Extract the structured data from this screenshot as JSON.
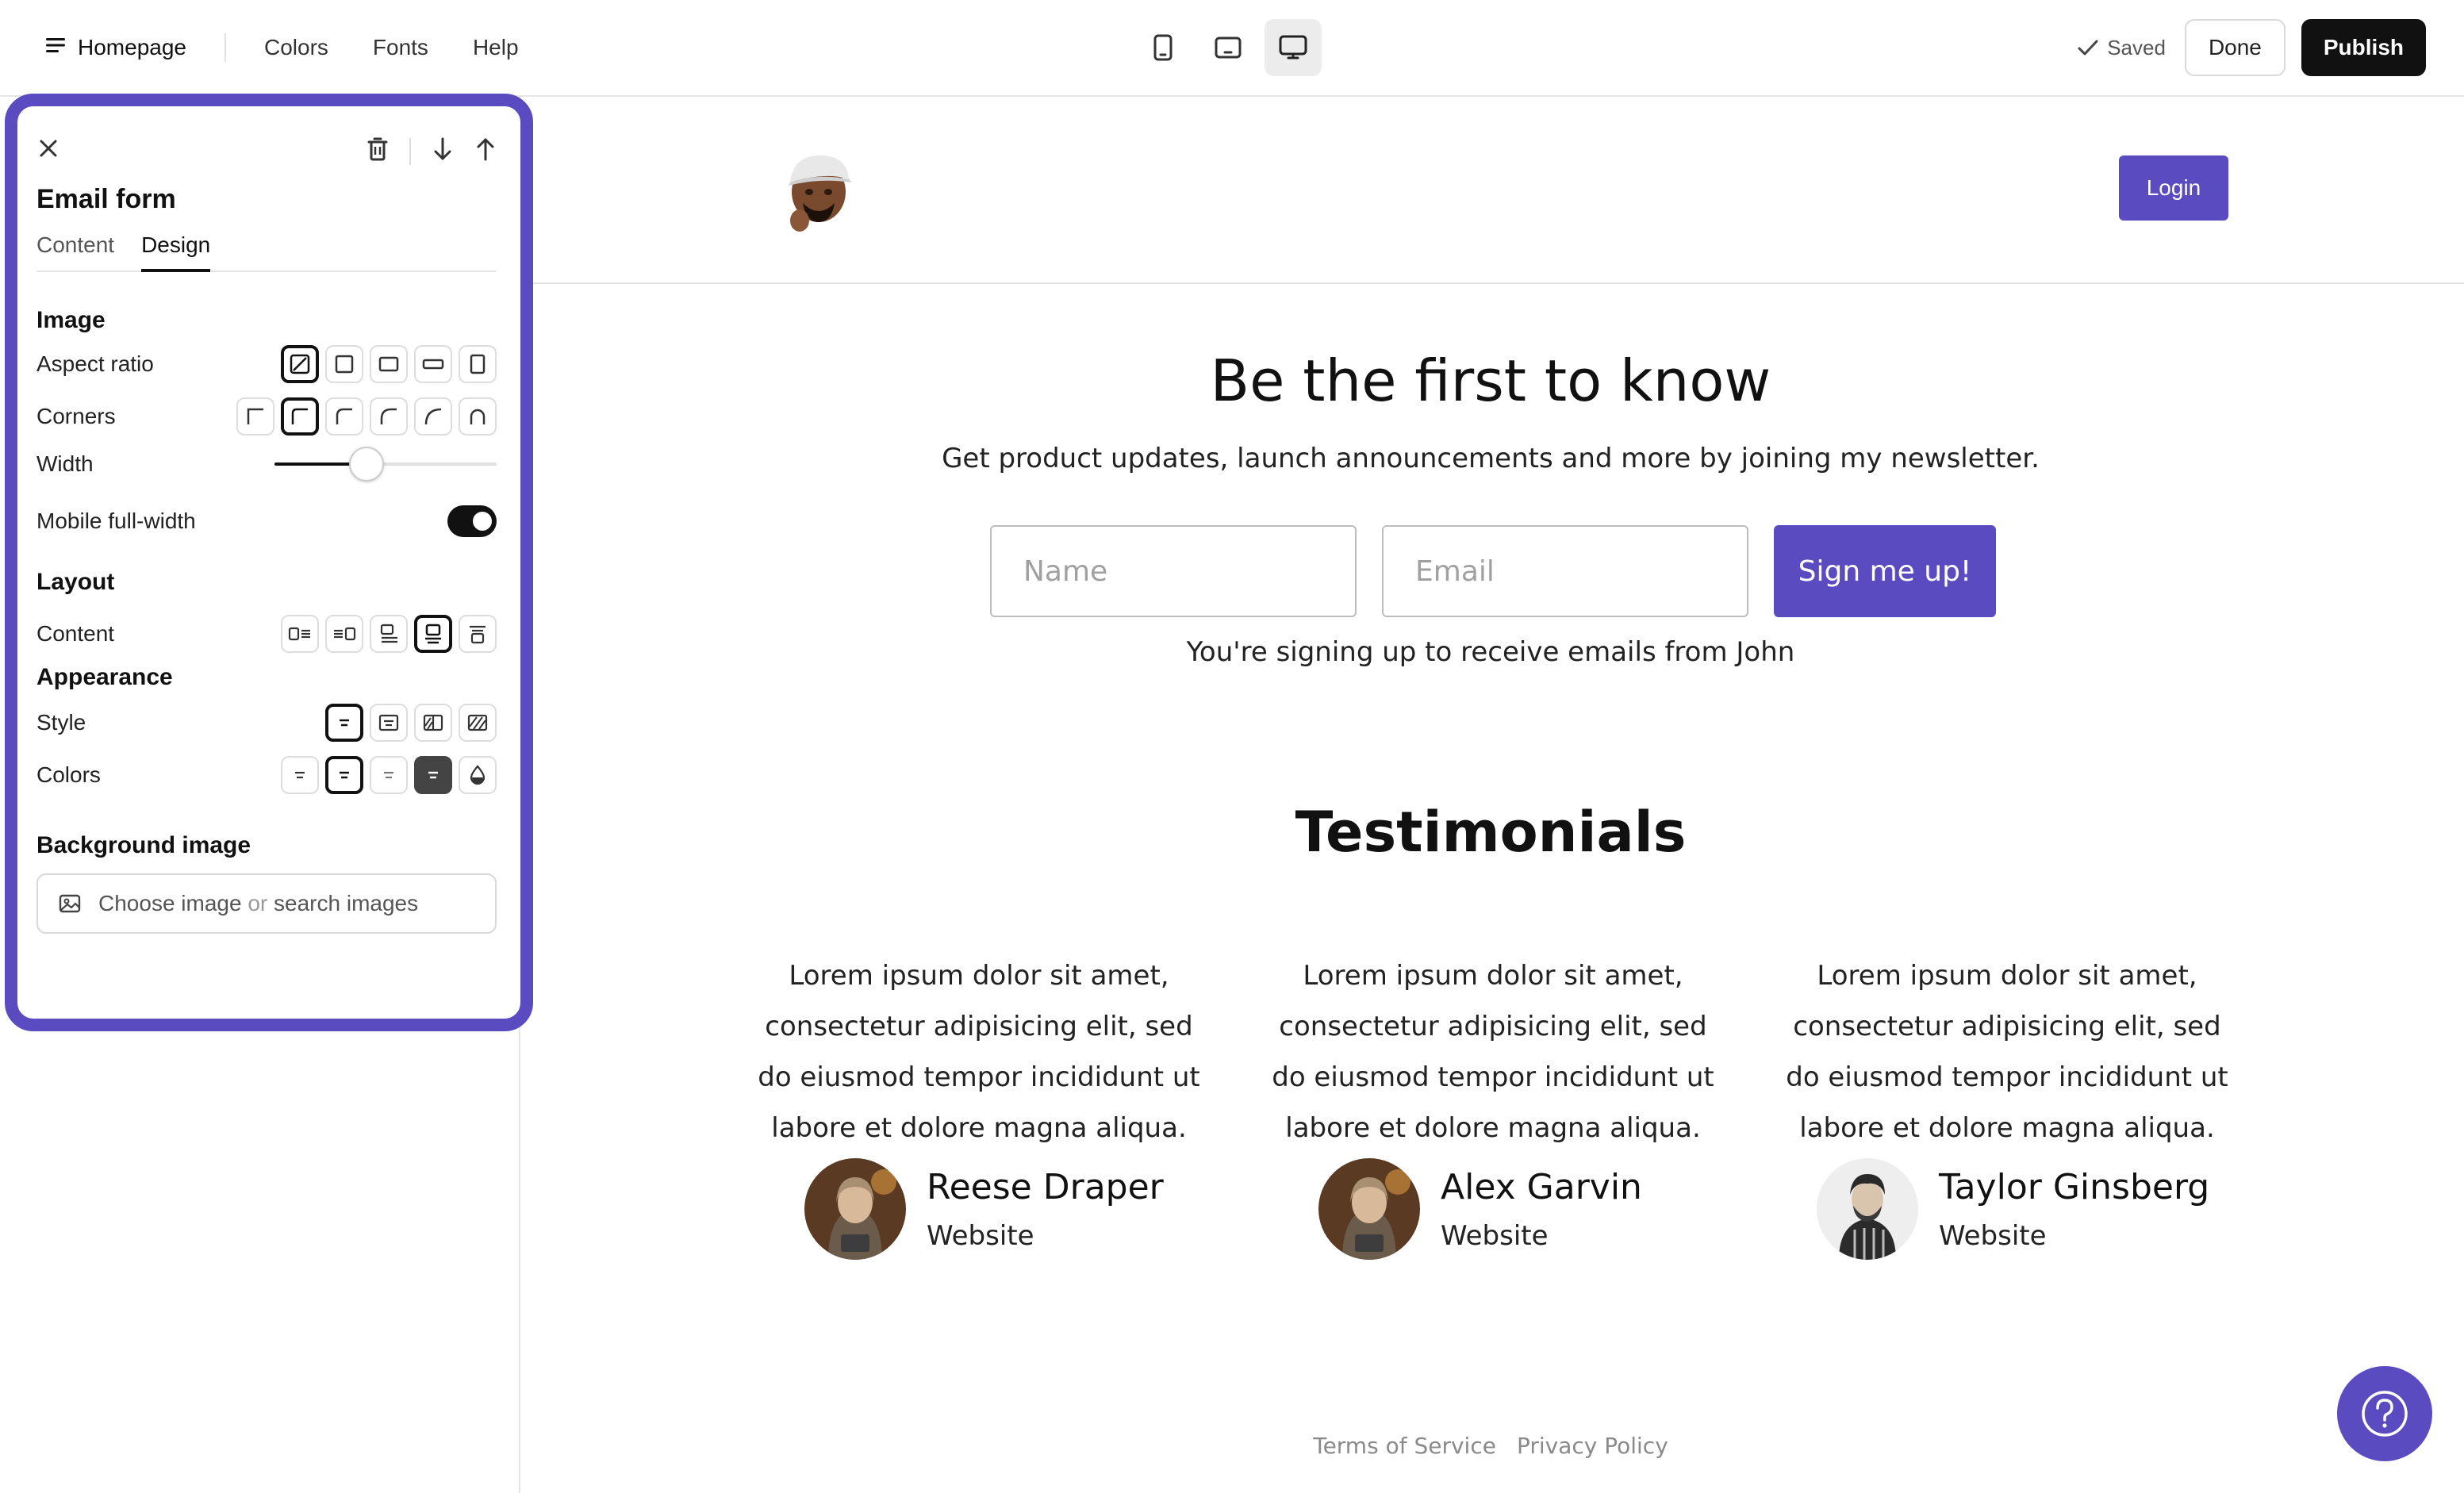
{
  "topbar": {
    "page_name": "Homepage",
    "links": [
      "Colors",
      "Fonts",
      "Help"
    ],
    "saved_label": "Saved",
    "done_label": "Done",
    "publish_label": "Publish"
  },
  "panel": {
    "title": "Email form",
    "tabs": [
      "Content",
      "Design"
    ],
    "active_tab": "Design",
    "image": {
      "heading": "Image",
      "aspect_ratio_label": "Aspect ratio",
      "corners_label": "Corners",
      "width_label": "Width",
      "width_value_percent": 40,
      "mobile_full_width_label": "Mobile full-width",
      "mobile_full_width_on": true
    },
    "layout": {
      "heading": "Layout",
      "content_label": "Content"
    },
    "appearance": {
      "heading": "Appearance",
      "style_label": "Style",
      "colors_label": "Colors"
    },
    "background": {
      "heading": "Background image",
      "choose_label": "Choose image",
      "or_label": "or",
      "search_label": "search images"
    }
  },
  "site": {
    "login_label": "Login",
    "hero_title": "Be the first to know",
    "hero_subtitle": "Get product updates, launch announcements and more by joining my newsletter.",
    "name_placeholder": "Name",
    "email_placeholder": "Email",
    "signup_label": "Sign me up!",
    "form_note": "You're signing up to receive emails from John",
    "testimonials_title": "Testimonials",
    "testimonials": [
      {
        "quote": "Lorem ipsum dolor sit amet, consectetur adipisicing elit, sed do eiusmod tempor incididunt ut labore et dolore magna aliqua.",
        "name": "Reese Draper",
        "link": "Website"
      },
      {
        "quote": "Lorem ipsum dolor sit amet, consectetur adipisicing elit, sed do eiusmod tempor incididunt ut labore et dolore magna aliqua.",
        "name": "Alex Garvin",
        "link": "Website"
      },
      {
        "quote": "Lorem ipsum dolor sit amet, consectetur adipisicing elit, sed do eiusmod tempor incididunt ut labore et dolore magna aliqua.",
        "name": "Taylor Ginsberg",
        "link": "Website"
      }
    ],
    "footer_links": [
      "Terms of Service",
      "Privacy Policy"
    ]
  },
  "colors": {
    "accent": "#5b4bc1",
    "dark": "#111111"
  },
  "icons": {
    "menu": "menu-icon",
    "close": "close-icon",
    "delete": "trash-icon",
    "move_down": "arrow-down-icon",
    "move_up": "arrow-up-icon",
    "help": "question-icon"
  }
}
